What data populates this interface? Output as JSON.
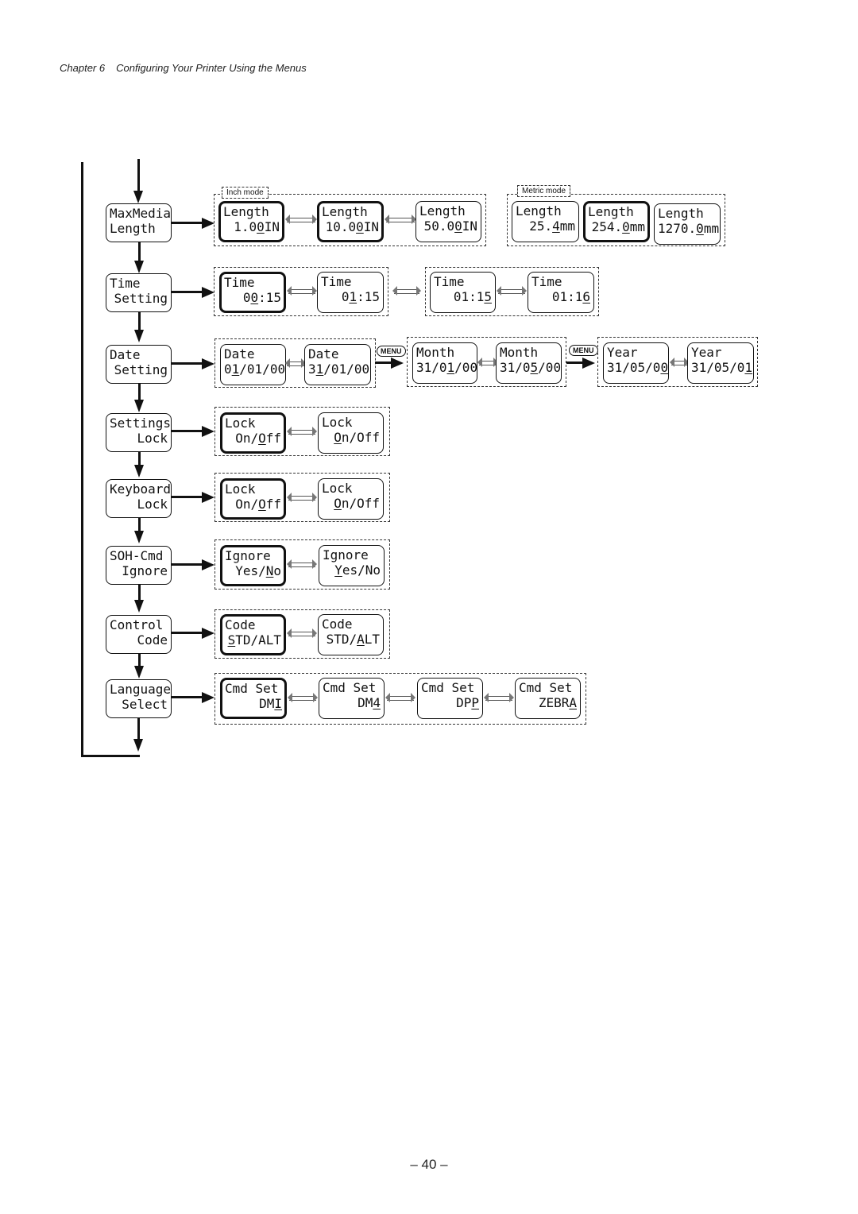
{
  "header": {
    "chapter": "Chapter 6",
    "title": "Configuring Your Printer Using the Menus"
  },
  "page_number": "– 40 –",
  "menus": [
    {
      "l1": "MaxMedia",
      "l2": "Length"
    },
    {
      "l1": "Time",
      "l2": "Setting"
    },
    {
      "l1": "Date",
      "l2": "Setting"
    },
    {
      "l1": "Settings",
      "l2": "Lock"
    },
    {
      "l1": "Keyboard",
      "l2": "Lock"
    },
    {
      "l1": "SOH-Cmd",
      "l2": "Ignore"
    },
    {
      "l1": "Control",
      "l2": "Code"
    },
    {
      "l1": "Language",
      "l2": "Select"
    }
  ],
  "tags": {
    "inch": "Inch mode",
    "metric": "Metric mode"
  },
  "menu_key": "MENU",
  "displays": {
    "length_inch": [
      {
        "l1": "Length",
        "pre": "1.0",
        "u": "0",
        "post": "IN"
      },
      {
        "l1": "Length",
        "pre": "10.0",
        "u": "0",
        "post": "IN"
      },
      {
        "l1": "Length",
        "pre": "50.0",
        "u": "0",
        "post": "IN"
      }
    ],
    "length_metric": [
      {
        "l1": "Length",
        "pre": "25.",
        "u": "4",
        "post": "mm"
      },
      {
        "l1": "Length",
        "pre": "254.",
        "u": "0",
        "post": "mm"
      },
      {
        "l1": "Length",
        "pre": "1270.",
        "u": "0",
        "post": "mm"
      }
    ],
    "time": [
      {
        "l1": "Time",
        "pre": "0",
        "u": "0",
        "post": ":15"
      },
      {
        "l1": "Time",
        "pre": "0",
        "u": "1",
        "post": ":15"
      },
      {
        "l1": "Time",
        "pre": "01:1",
        "u": "5",
        "post": ""
      },
      {
        "l1": "Time",
        "pre": "01:1",
        "u": "6",
        "post": ""
      }
    ],
    "date": [
      {
        "l1": "Date",
        "pre": "0",
        "u": "1",
        "post": "/01/00"
      },
      {
        "l1": "Date",
        "pre": "3",
        "u": "1",
        "post": "/01/00"
      }
    ],
    "month": [
      {
        "l1": "Month",
        "pre": "31/0",
        "u": "1",
        "post": "/00"
      },
      {
        "l1": "Month",
        "pre": "31/0",
        "u": "5",
        "post": "/00"
      }
    ],
    "year": [
      {
        "l1": "Year",
        "pre": "31/05/0",
        "u": "0",
        "post": ""
      },
      {
        "l1": "Year",
        "pre": "31/05/0",
        "u": "1",
        "post": ""
      }
    ],
    "settings_lock": [
      {
        "l1": "Lock",
        "pre": "On/",
        "u": "O",
        "post": "ff"
      },
      {
        "l1": "Lock",
        "pre": "",
        "u": "O",
        "post": "n/Off"
      }
    ],
    "keyboard_lock": [
      {
        "l1": "Lock",
        "pre": "On/",
        "u": "O",
        "post": "ff"
      },
      {
        "l1": "Lock",
        "pre": "",
        "u": "O",
        "post": "n/Off"
      }
    ],
    "soh": [
      {
        "l1": "Ignore",
        "pre": "Yes/",
        "u": "N",
        "post": "o"
      },
      {
        "l1": "Ignore",
        "pre": "",
        "u": "Y",
        "post": "es/No"
      }
    ],
    "control": [
      {
        "l1": "Code",
        "pre": "",
        "u": "S",
        "post": "TD/ALT"
      },
      {
        "l1": "Code",
        "pre": "STD/",
        "u": "A",
        "post": "LT"
      }
    ],
    "cmdset": [
      {
        "l1": "Cmd Set",
        "pre": "DM",
        "u": "I",
        "post": ""
      },
      {
        "l1": "Cmd Set",
        "pre": "DM",
        "u": "4",
        "post": ""
      },
      {
        "l1": "Cmd Set",
        "pre": "DP",
        "u": "P",
        "post": ""
      },
      {
        "l1": "Cmd Set",
        "pre": "ZEBR",
        "u": "A",
        "post": ""
      }
    ]
  }
}
